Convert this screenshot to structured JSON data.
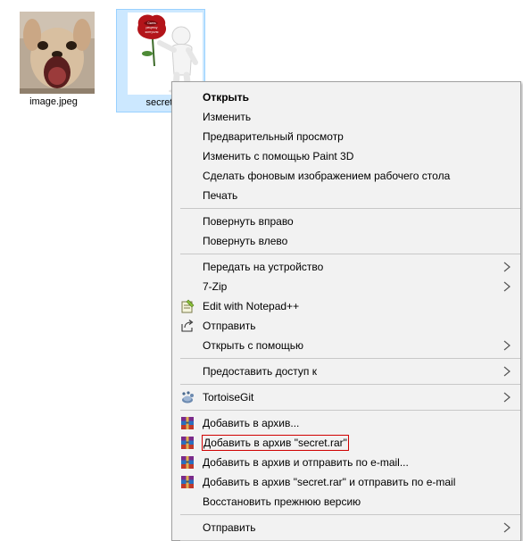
{
  "files": [
    {
      "name": "image.jpeg",
      "selected": false
    },
    {
      "name": "secret.",
      "selected": true
    }
  ],
  "thumb_text": "Cкинь\nреценку\nконтроля",
  "context_menu": {
    "items": [
      {
        "label": "Открыть",
        "bold": true
      },
      {
        "label": "Изменить"
      },
      {
        "label": "Предварительный просмотр"
      },
      {
        "label": "Изменить с помощью Paint 3D"
      },
      {
        "label": "Сделать фоновым изображением рабочего стола"
      },
      {
        "label": "Печать"
      },
      {
        "label": "Повернуть вправо"
      },
      {
        "label": "Повернуть влево"
      },
      {
        "label": "Передать на устройство",
        "submenu": true
      },
      {
        "label": "7-Zip",
        "submenu": true
      },
      {
        "label": "Edit with Notepad++",
        "icon": "notepad-plus-plus-icon"
      },
      {
        "label": "Отправить",
        "icon": "share-icon"
      },
      {
        "label": "Открыть с помощью",
        "submenu": true
      },
      {
        "label": "Предоставить доступ к",
        "submenu": true
      },
      {
        "label": "TortoiseGit",
        "icon": "tortoisegit-icon",
        "submenu": true
      },
      {
        "label": "Добавить в архив...",
        "icon": "winrar-icon"
      },
      {
        "label": "Добавить в архив \"secret.rar\"",
        "icon": "winrar-icon",
        "highlighted_box": true
      },
      {
        "label": "Добавить в архив и отправить по e-mail...",
        "icon": "winrar-icon"
      },
      {
        "label": "Добавить в архив \"secret.rar\" и отправить по e-mail",
        "icon": "winrar-icon"
      },
      {
        "label": "Восстановить прежнюю версию"
      },
      {
        "label": "Отправить",
        "submenu": true
      }
    ]
  },
  "colors": {
    "selection_bg": "#cce8ff",
    "menu_bg": "#f2f2f2",
    "highlight_border": "#d00000"
  }
}
